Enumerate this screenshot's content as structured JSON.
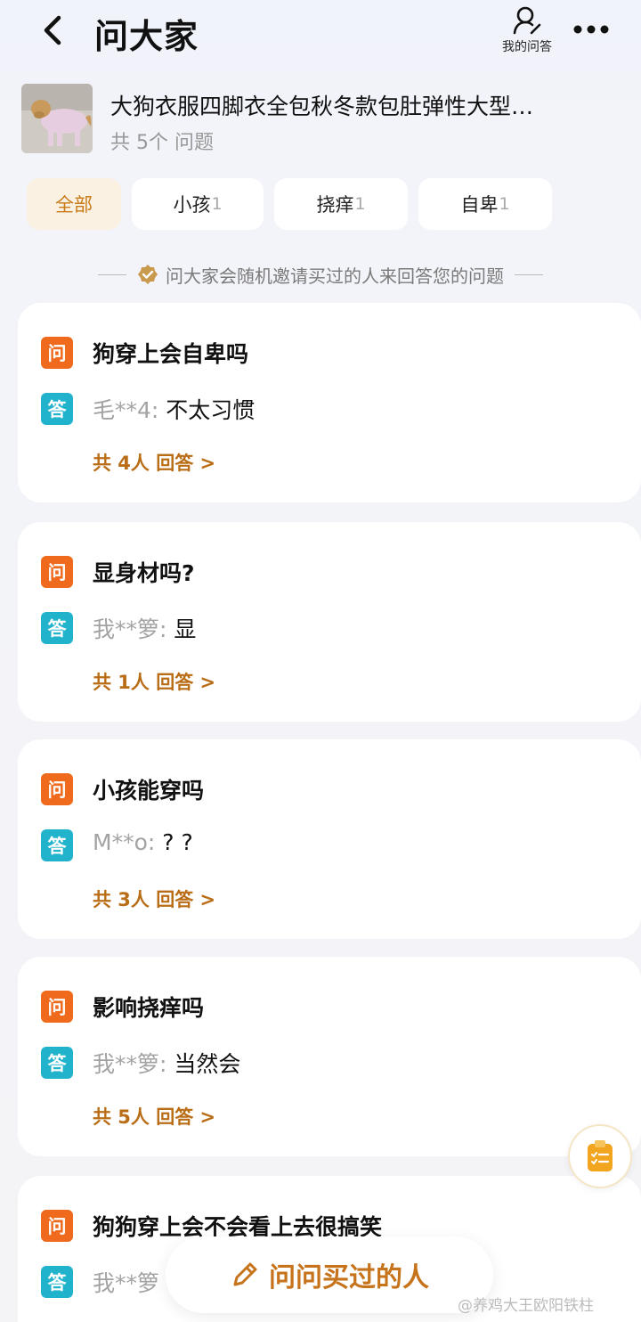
{
  "header": {
    "title": "问大家",
    "my_qa_label": "我的问答",
    "icons": {
      "back": "chevron-left-icon",
      "my_qa": "user-edit-icon",
      "more": "more-dots-icon"
    }
  },
  "product": {
    "title": "大狗衣服四脚衣全包秋冬款包肚弹性大型…",
    "question_count": "共 5个 问题"
  },
  "filters": [
    {
      "label": "全部",
      "count": ""
    },
    {
      "label": "小孩",
      "count": "1"
    },
    {
      "label": "挠痒",
      "count": "1"
    },
    {
      "label": "自卑",
      "count": "1"
    }
  ],
  "notice": "问大家会随机邀请买过的人来回答您的问题",
  "tags": {
    "q": "问",
    "a": "答"
  },
  "questions": [
    {
      "question": "狗穿上会自卑吗",
      "user": "毛**4:",
      "answer": "不太习惯",
      "more": "共 4人 回答 >"
    },
    {
      "question": "显身材吗?",
      "user": "我**箩:",
      "answer": "显",
      "more": "共 1人 回答 >"
    },
    {
      "question": "小孩能穿吗",
      "user": "M**o:",
      "answer": "? ?",
      "more": "共 3人 回答 >"
    },
    {
      "question": "影响挠痒吗",
      "user": "我**箩:",
      "answer": "当然会",
      "more": "共 5人 回答 >"
    },
    {
      "question": "狗狗穿上会不会看上去很搞笑",
      "user": "我**箩",
      "answer": "",
      "more": ""
    }
  ],
  "ask_button": "问问买过的人",
  "watermark": "@养鸡大王欧阳铁柱",
  "colors": {
    "accent": "#c6731b",
    "q_tag": "#f06a1d",
    "a_tag": "#22b3cc",
    "active_filter_bg": "#fbf1e3"
  }
}
